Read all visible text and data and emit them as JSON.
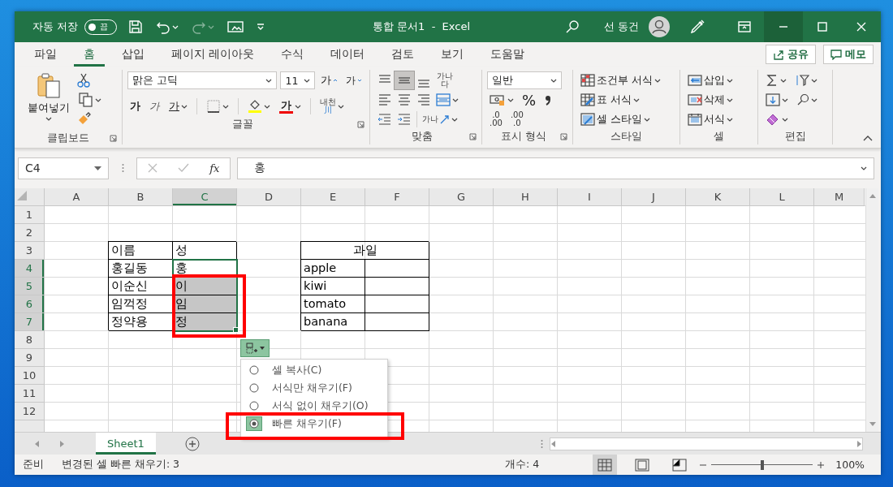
{
  "title_bar": {
    "autosave_label": "자동 저장",
    "autosave_toggle": {
      "text": "끔",
      "on": false
    },
    "redo_disabled": true,
    "title": "통합 문서1  -  Excel",
    "user": "선 동건"
  },
  "ribbon_tabs": [
    {
      "label": "파일",
      "selected": false
    },
    {
      "label": "홈",
      "selected": true
    },
    {
      "label": "삽입",
      "selected": false
    },
    {
      "label": "페이지 레이아웃",
      "selected": false
    },
    {
      "label": "수식",
      "selected": false
    },
    {
      "label": "데이터",
      "selected": false
    },
    {
      "label": "검토",
      "selected": false
    },
    {
      "label": "보기",
      "selected": false
    },
    {
      "label": "도움말",
      "selected": false
    }
  ],
  "share_button": "공유",
  "comment_button": "메모",
  "clipboard": {
    "paste": "붙여넣기",
    "label": "클립보드"
  },
  "font": {
    "name": "맑은 고딕",
    "size": "11",
    "grow": "가",
    "shrink": "가",
    "bold": "가",
    "italic": "가",
    "underline": "가",
    "font_color": "가",
    "phonetic": "내천",
    "phonetic_mark": "川",
    "label": "글꼴"
  },
  "alignment": {
    "vertical_align": [
      {
        "kind": "top",
        "selected": false
      },
      {
        "kind": "middle",
        "selected": true
      },
      {
        "kind": "bottom",
        "selected": false
      }
    ],
    "wrap_text": "가나다",
    "orientation_text": "가나",
    "label": "맞춤"
  },
  "number": {
    "format": "일반",
    "percent": "%",
    "decimal_buttons": [
      {
        "top": ".0",
        "bottom": ".00"
      },
      {
        "top": ".00",
        "bottom": ".0"
      }
    ],
    "label": "표시 형식"
  },
  "styles": {
    "items": [
      {
        "kind": "conditional",
        "label": "조건부 서식"
      },
      {
        "kind": "table",
        "label": "표 서식"
      },
      {
        "kind": "cell",
        "label": "셀 스타일"
      }
    ],
    "label": "스타일"
  },
  "cells": {
    "items": [
      {
        "kind": "insert",
        "label": "삽입"
      },
      {
        "kind": "delete",
        "label": "삭제"
      },
      {
        "kind": "format",
        "label": "서식"
      }
    ],
    "label": "셀"
  },
  "editing": {
    "label": "편집"
  },
  "formula_bar": {
    "name_box": "C4",
    "function_button": "fx",
    "formula": "홍"
  },
  "sheet": {
    "columns": [
      {
        "label": "A",
        "selected": false
      },
      {
        "label": "B",
        "selected": false
      },
      {
        "label": "C",
        "selected": true
      },
      {
        "label": "D",
        "selected": false
      },
      {
        "label": "E",
        "selected": false
      },
      {
        "label": "F",
        "selected": false
      },
      {
        "label": "G",
        "selected": false
      },
      {
        "label": "H",
        "selected": false
      },
      {
        "label": "I",
        "selected": false
      },
      {
        "label": "J",
        "selected": false
      },
      {
        "label": "K",
        "selected": false
      },
      {
        "label": "L",
        "selected": false
      },
      {
        "label": "M",
        "selected": false
      }
    ],
    "row_headers": [
      {
        "label": "1",
        "selected": false
      },
      {
        "label": "2",
        "selected": false
      },
      {
        "label": "3",
        "selected": false
      },
      {
        "label": "4",
        "selected": true
      },
      {
        "label": "5",
        "selected": true
      },
      {
        "label": "6",
        "selected": true
      },
      {
        "label": "7",
        "selected": true
      },
      {
        "label": "8",
        "selected": false
      },
      {
        "label": "9",
        "selected": false
      },
      {
        "label": "10",
        "selected": false
      },
      {
        "label": "11",
        "selected": false
      },
      {
        "label": "12",
        "selected": false
      }
    ],
    "tables": [
      {
        "header": [
          {
            "text": "이름"
          },
          {
            "text": "성"
          }
        ],
        "rows": [
          {
            "cells": [
              {
                "text": "홍길동",
                "selected": false
              },
              {
                "text": "홍",
                "selected": false
              }
            ]
          },
          {
            "cells": [
              {
                "text": "이순신",
                "selected": false
              },
              {
                "text": "이",
                "selected": true
              }
            ]
          },
          {
            "cells": [
              {
                "text": "임꺽정",
                "selected": false
              },
              {
                "text": "임",
                "selected": true
              }
            ]
          },
          {
            "cells": [
              {
                "text": "정약용",
                "selected": false
              },
              {
                "text": "정",
                "selected": true
              }
            ]
          }
        ]
      },
      {
        "title": "과일",
        "rows": [
          {
            "cells": [
              {
                "text": "apple",
                "selected": false
              },
              {
                "selected": false
              }
            ]
          },
          {
            "cells": [
              {
                "text": "kiwi",
                "selected": false
              },
              {
                "selected": false
              }
            ]
          },
          {
            "cells": [
              {
                "text": "tomato",
                "selected": false
              },
              {
                "selected": false
              }
            ]
          },
          {
            "cells": [
              {
                "text": "banana",
                "selected": false
              },
              {
                "selected": false
              }
            ]
          }
        ]
      }
    ]
  },
  "autofill_options": [
    {
      "label": "셀 복사(C)",
      "selected": false
    },
    {
      "label": "서식만 채우기(F)",
      "selected": false
    },
    {
      "label": "서식 없이 채우기(O)",
      "selected": false
    },
    {
      "label": "빠른 채우기(F)",
      "selected": true
    }
  ],
  "annotations": {
    "selection_frame": true,
    "option_frame": true
  },
  "sheet_tabs": [
    {
      "label": "Sheet1",
      "selected": true
    }
  ],
  "status_bar": {
    "mode": "준비",
    "message": "변경된 셀 빠른 채우기: 3",
    "count": "개수: 4",
    "views": [
      {
        "kind": "normal",
        "selected": true
      },
      {
        "kind": "page_layout",
        "selected": false
      },
      {
        "kind": "page_break",
        "selected": false
      }
    ],
    "zoom": {
      "level": 0.5,
      "text": "100%"
    }
  }
}
